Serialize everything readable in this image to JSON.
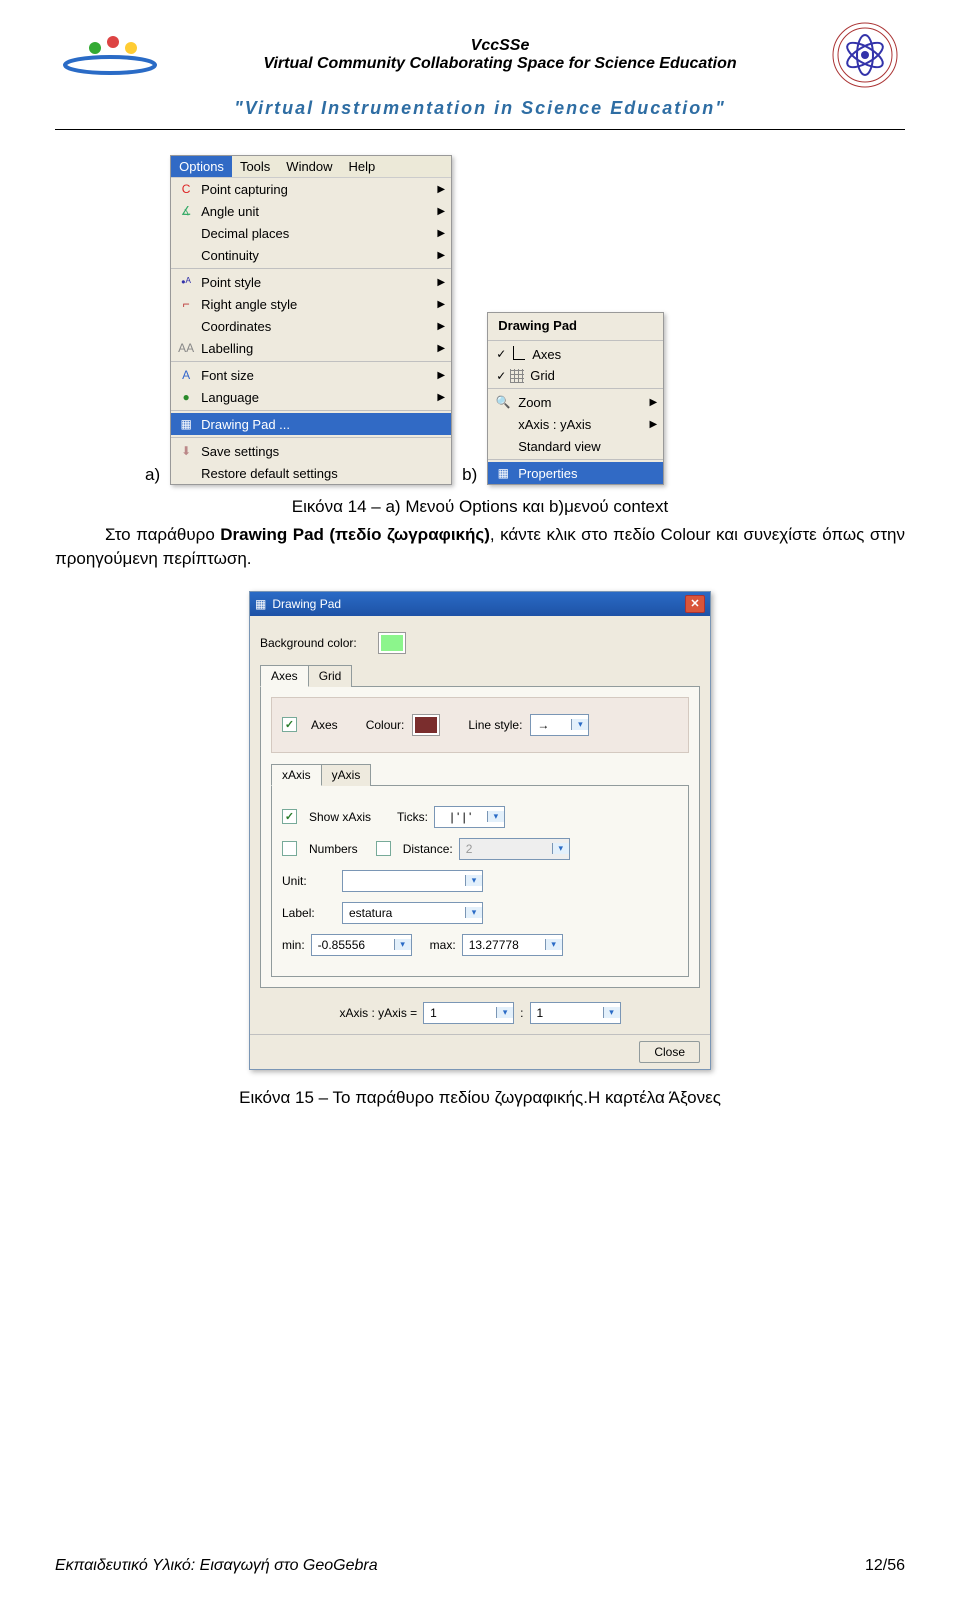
{
  "header": {
    "line1": "VccSSe",
    "line2": "Virtual Community Collaborating Space for Science Education",
    "sub": "\"Virtual Instrumentation in Science Education\""
  },
  "figA_label": "a)",
  "figB_label": "b)",
  "menuA": {
    "bar": [
      "Options",
      "Tools",
      "Window",
      "Help"
    ],
    "sec1": [
      {
        "ico": "C",
        "label": "Point capturing",
        "arrow": true,
        "color": "#d22"
      },
      {
        "ico": "∡",
        "label": "Angle unit",
        "arrow": true,
        "color": "#3a6"
      },
      {
        "ico": "",
        "label": "Decimal places",
        "arrow": true
      },
      {
        "ico": "",
        "label": "Continuity",
        "arrow": true
      }
    ],
    "sec2": [
      {
        "ico": "•ᴬ",
        "label": "Point style",
        "arrow": true,
        "color": "#33a"
      },
      {
        "ico": "⌐",
        "label": "Right angle style",
        "arrow": true,
        "color": "#b33"
      },
      {
        "ico": "",
        "label": "Coordinates",
        "arrow": true
      },
      {
        "ico": "AA",
        "label": "Labelling",
        "arrow": true,
        "color": "#888"
      }
    ],
    "sec3": [
      {
        "ico": "A",
        "label": "Font size",
        "arrow": true,
        "color": "#36c"
      },
      {
        "ico": "●",
        "label": "Language",
        "arrow": true,
        "color": "#2a8a2a"
      }
    ],
    "sec4": [
      {
        "ico": "▦",
        "label": "Drawing Pad ...",
        "arrow": false,
        "hl": true,
        "color": "#fff"
      }
    ],
    "sec5": [
      {
        "ico": "⬇",
        "label": "Save settings",
        "arrow": false,
        "color": "#b88"
      },
      {
        "ico": "",
        "label": "Restore default settings",
        "arrow": false
      }
    ]
  },
  "menuB": {
    "title": "Drawing Pad",
    "items": [
      {
        "check": true,
        "glyph": "axes",
        "label": "Axes"
      },
      {
        "check": true,
        "glyph": "grid",
        "label": "Grid"
      }
    ],
    "items2": [
      {
        "ico": "🔍",
        "label": "Zoom",
        "arrow": true
      },
      {
        "ico": "",
        "label": "xAxis : yAxis",
        "arrow": true
      },
      {
        "ico": "",
        "label": "Standard view",
        "arrow": false
      }
    ],
    "props": {
      "ico": "▦",
      "label": "Properties",
      "hl": true
    }
  },
  "caption14": "Εικόνα 14 – a) Μενού Options και b)μενού context",
  "para": {
    "pre": "Στο παράθυρο ",
    "bold": "Drawing Pad (πεδίο ζωγραφικής)",
    "post": ", κάντε κλικ στο πεδίο Colour και συνεχίστε όπως στην προηγούμενη περίπτωση."
  },
  "dialog": {
    "title": "Drawing Pad",
    "bg_label": "Background color:",
    "tabs": [
      "Axes",
      "Grid"
    ],
    "axes_chk": "Axes",
    "colour_lbl": "Colour:",
    "linestyle_lbl": "Line style:",
    "linestyle_val": "→",
    "subtabs": [
      "xAxis",
      "yAxis"
    ],
    "showx_chk": "Show xAxis",
    "ticks_lbl": "Ticks:",
    "ticks_val": "| ' | '",
    "numbers_chk": "Numbers",
    "distance_chk": "Distance:",
    "distance_val": "2",
    "unit_lbl": "Unit:",
    "unit_val": "",
    "label_lbl": "Label:",
    "label_val": "estatura",
    "min_lbl": "min:",
    "min_val": "-0.85556",
    "max_lbl": "max:",
    "max_val": "13.27778",
    "ratio_lbl": "xAxis : yAxis =",
    "ratio_a": "1",
    "ratio_sep": ":",
    "ratio_b": "1",
    "close": "Close"
  },
  "caption15": "Εικόνα 15 – Το παράθυρο πεδίου ζωγραφικής.Η καρτέλα Άξονες",
  "footer": {
    "left": "Εκπαιδευτικό Υλικό: Εισαγωγή στο GeoGebra",
    "right": "12/56"
  }
}
